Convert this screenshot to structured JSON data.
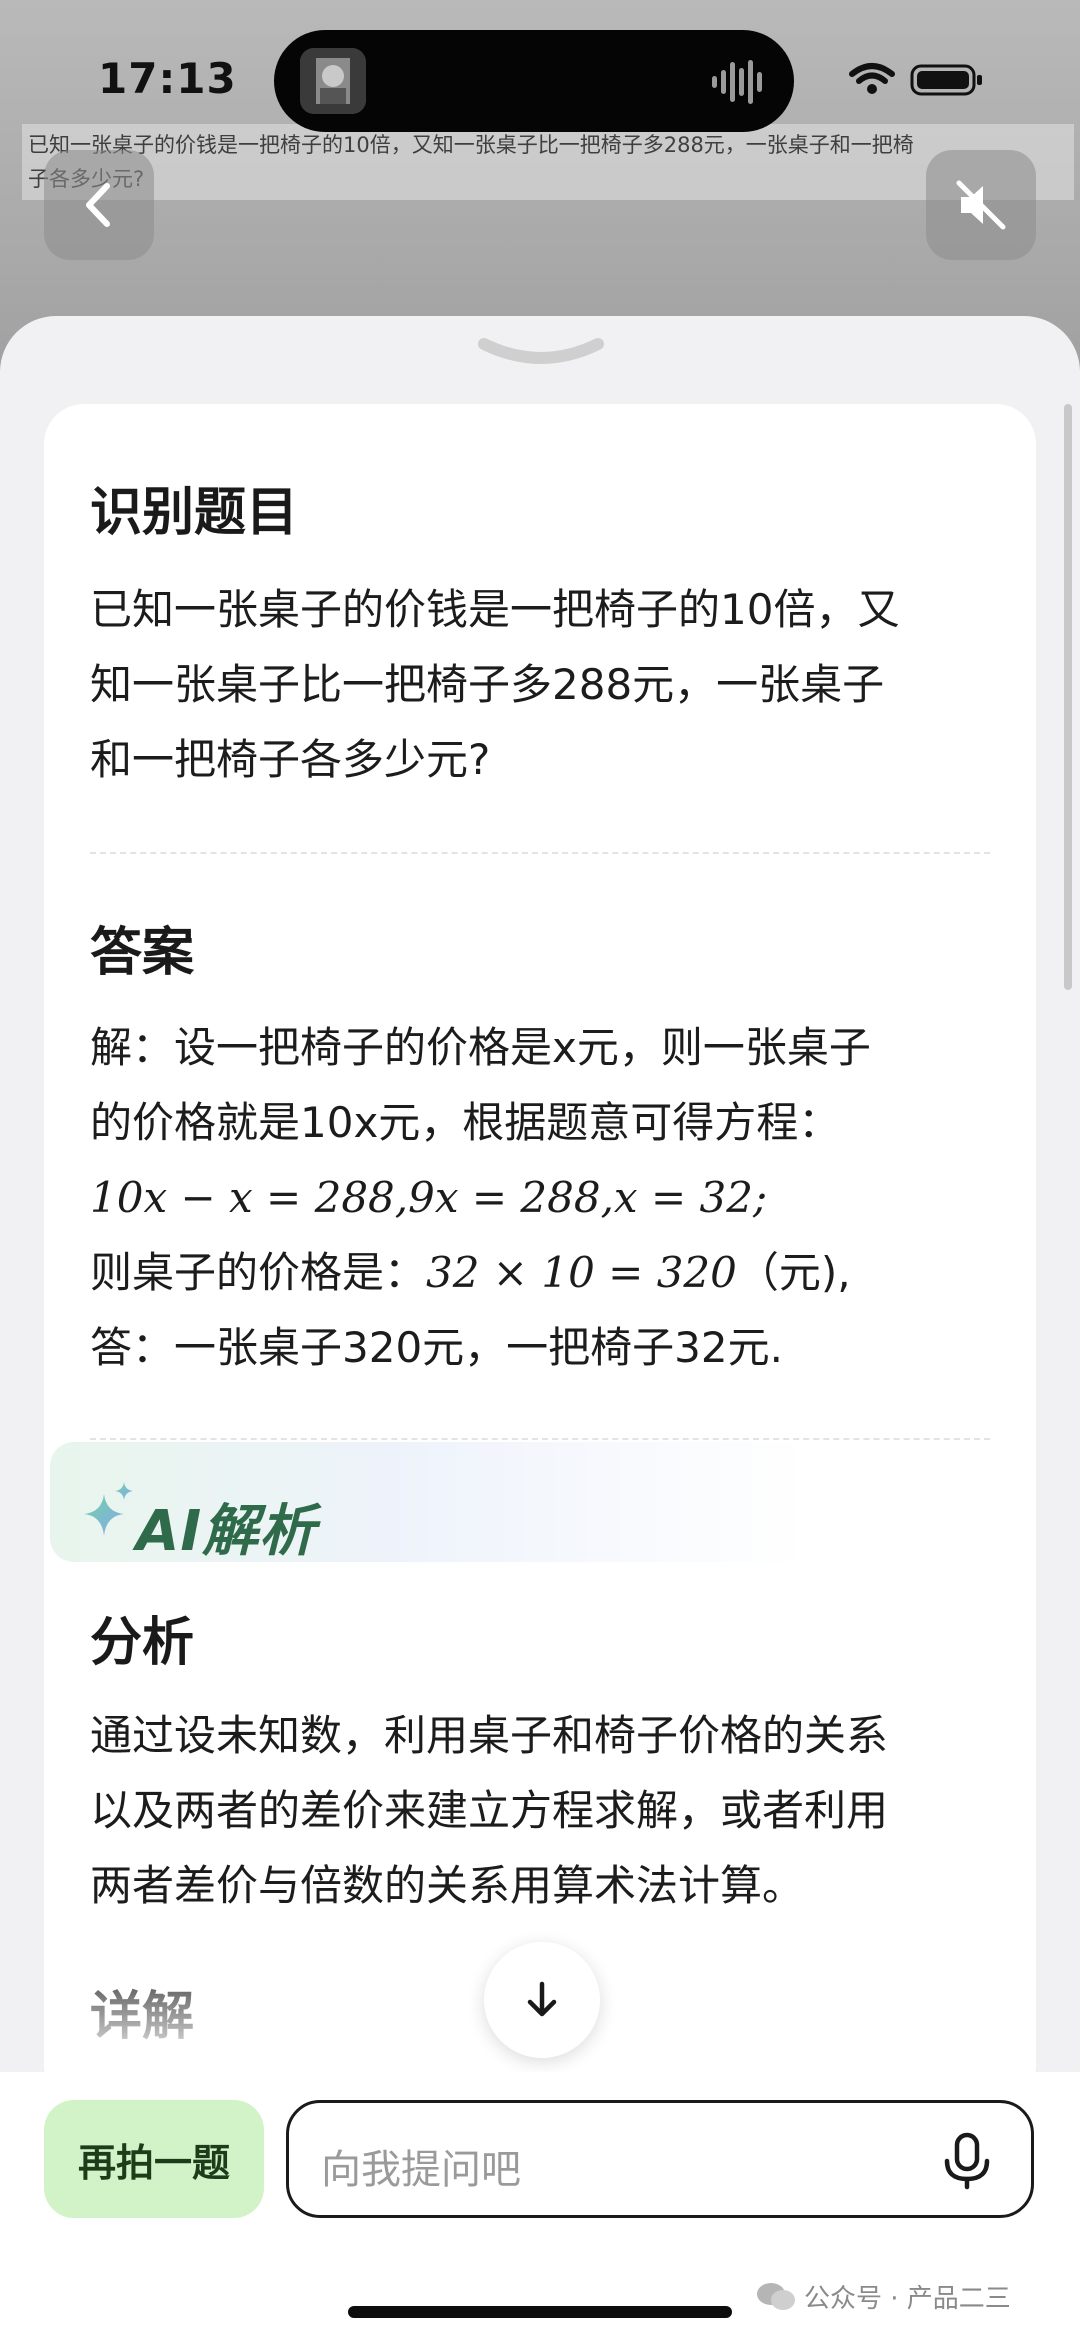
{
  "status_bar": {
    "time": "17:13"
  },
  "background": {
    "question_snippet_line1": "已知一张桌子的价钱是一把椅子的10倍，又知一张桌子比一把椅子多288元，一张桌子和一把椅",
    "question_snippet_line2": "子各多少元?"
  },
  "sections": {
    "recognize_title": "识别题目",
    "question_lines": [
      "已知一张桌子的价钱是一把椅子的10倍，又",
      "知一张桌子比一把椅子多288元，一张桌子",
      "和一把椅子各多少元?"
    ],
    "answer_title": "答案",
    "answer_line1": "解：设一把椅子的价格是x元，则一张桌子",
    "answer_line2": "的价格就是10x元，根据题意可得方程：",
    "answer_math": "10x − x = 288,9x = 288,x = 32;",
    "answer_line4_prefix": "则桌子的价格是：",
    "answer_line4_math": "32 × 10 = 320",
    "answer_line4_suffix": "（元),",
    "answer_line5": "答：一张桌子320元，一把椅子32元.",
    "ai_label": "AI解析",
    "analysis_title": "分析",
    "analysis_lines": [
      "通过设未知数，利用桌子和椅子价格的关系",
      "以及两者的差价来建立方程求解，或者利用",
      "两者差价与倍数的关系用算术法计算。"
    ],
    "detail_title": "详解"
  },
  "bottom": {
    "retake_label": "再拍一题",
    "ask_placeholder": "向我提问吧"
  },
  "watermark": "公众号 · 产品二三",
  "colors": {
    "accent_green": "#d2f3c8",
    "ai_green": "#2f6b4a",
    "sheet_bg": "#f1f1f3"
  },
  "icons": [
    "back-icon",
    "mute-icon",
    "chevron-down-icon",
    "sparkle-icon",
    "arrow-down-icon",
    "mic-icon",
    "wifi-icon",
    "battery-icon",
    "audio-wave-icon"
  ]
}
